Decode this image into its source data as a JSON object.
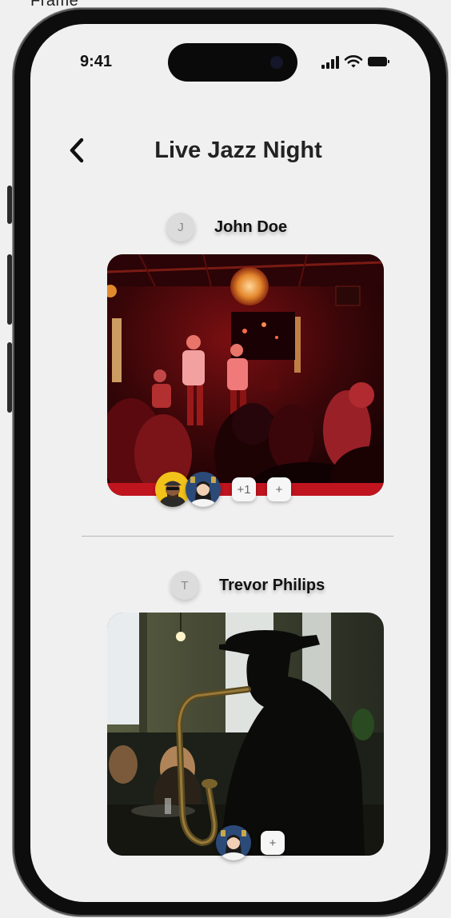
{
  "frame_label": "Frame",
  "status_bar": {
    "time": "9:41"
  },
  "header": {
    "title": "Live Jazz Night"
  },
  "posts": [
    {
      "author": {
        "initial": "J",
        "name": "John Doe"
      },
      "photo_icon": "band-on-stage-photo",
      "reactions": {
        "extra_count": "+1",
        "add_label": "+"
      }
    },
    {
      "author": {
        "initial": "T",
        "name": "Trevor Philips"
      },
      "photo_icon": "saxophone-player-photo",
      "reactions": {
        "add_label": "+"
      }
    }
  ],
  "colors": {
    "background": "#f0f0f0",
    "title": "#222222",
    "accent_red": "#c0141e"
  }
}
